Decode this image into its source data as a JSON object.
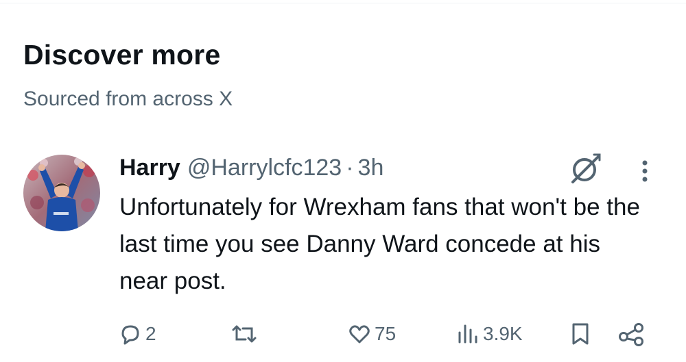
{
  "section": {
    "title": "Discover more",
    "subtitle": "Sourced from across X"
  },
  "tweet": {
    "author_name": "Harry",
    "author_handle": "@Harrylcfc123",
    "separator": "·",
    "time": "3h",
    "text": "Unfortunately for Wrexham fans that won't be the last time you see Danny Ward concede at his near post.",
    "reply_count": "2",
    "like_count": "75",
    "view_count": "3.9K"
  },
  "icons": {
    "header": [
      "grok-icon",
      "more-options-icon"
    ],
    "actions": [
      "reply-icon",
      "retweet-icon",
      "like-icon",
      "views-icon",
      "bookmark-icon",
      "share-icon"
    ]
  },
  "colors": {
    "text_primary": "#0f1419",
    "text_secondary": "#536471",
    "divider": "#eff3f4",
    "avatar_kit": "#1d4fa8"
  }
}
